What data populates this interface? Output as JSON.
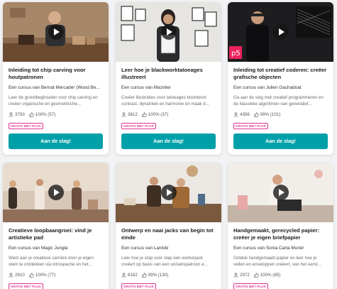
{
  "colors": {
    "accent": "#00a0a8",
    "badge": "#e2328f"
  },
  "icons": {
    "students": "person-icon",
    "rating": "thumbs-up-icon",
    "play": "play-icon"
  },
  "courses": [
    {
      "title": "Inleiding tot chip carving voor houtpatronen",
      "teacher": "Een cursus van Bernat Mercader (Wood Be...",
      "description": "Leer de grondbeginselen voor chip carving en creëer organische en geometrische...",
      "students": "3793",
      "rating": "100% (57)",
      "badge": "GRATIS MET PLUS",
      "cta": "Aan de slag!"
    },
    {
      "title": "Leer hoe je blackworktatoeages illustreert",
      "teacher": "Een cursus van Mazvtier",
      "description": "Creëer illustraties voor tatoeages boordevol contrast, dynamiek en harmonie en maak d...",
      "students": "3812",
      "rating": "100% (37)",
      "badge": "GRATIS MET PLUS",
      "cta": "Aan de slag!"
    },
    {
      "title": "Inleiding tot creatief coderen: creëer grafische objecten",
      "teacher": "Een cursus van Julien Gachadoat",
      "description": "Ga aan de slag met creatief programmeren en de klassieke algoritmen van generatief...",
      "students": "4356",
      "rating": "99% (101)",
      "badge": "GRATIS MET PLUS",
      "cta": "Aan de slag!"
    },
    {
      "title": "Creatieve loopbaangroei: vind je artistieke pad",
      "teacher": "Een cursus van Magic Jungla",
      "description": "Werk aan je creatieve carrière door je eigen stem te ontdekken via introspectie en het...",
      "students": "2610",
      "rating": "100% (77)",
      "badge": "GRATIS MET PLUS"
    },
    {
      "title": "Ontwerp en naai jacks van begin tot einde",
      "teacher": "Een cursus van Lantoki",
      "description": "Leer hoe je stap voor stap een workerjack creëert op basis van een unisekspatroon e...",
      "students": "6182",
      "rating": "99% (130)",
      "badge": "GRATIS MET PLUS"
    },
    {
      "title": "Handgemaakt, gerecycled papier: creëer je eigen briefpapier",
      "teacher": "Een cursus van Sonia Carta Muriel",
      "description": "Ontdek handgemaakt papier en leer hoe je vellen en enveloppen creëert, van het eerst...",
      "students": "2972",
      "rating": "100% (85)",
      "badge": "GRATIS MET PLUS"
    }
  ]
}
